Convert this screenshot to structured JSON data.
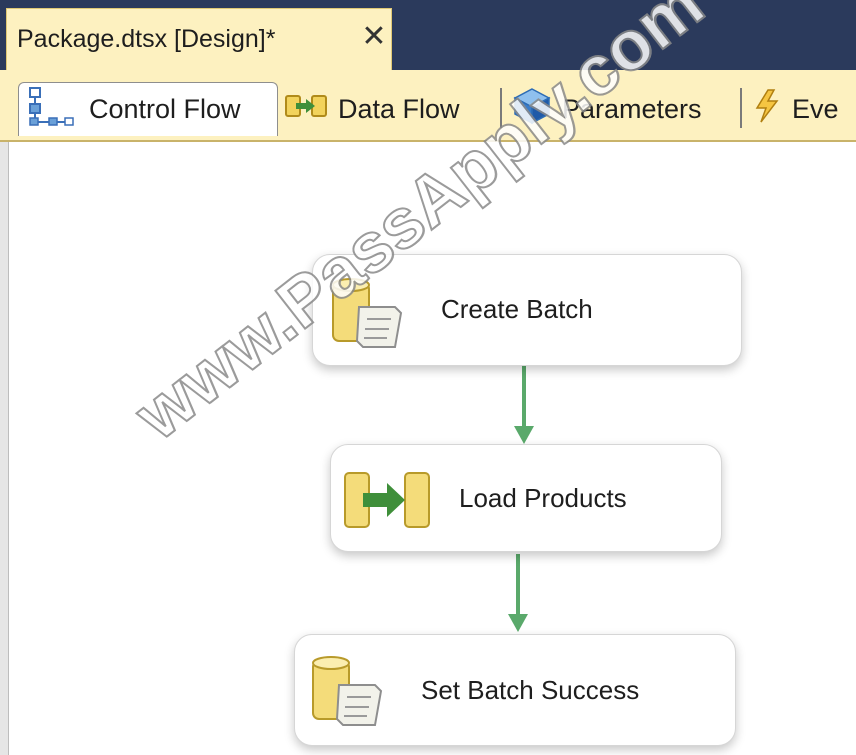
{
  "document_tab": {
    "title": "Package.dtsx [Design]*",
    "close_glyph": "✕"
  },
  "designer_tabs": [
    {
      "label": "Control Flow",
      "icon": "control-flow-icon",
      "active": true
    },
    {
      "label": "Data Flow",
      "icon": "data-flow-icon",
      "active": false
    },
    {
      "label": "Parameters",
      "icon": "parameters-icon",
      "active": false
    },
    {
      "label": "Eve",
      "icon": "event-handlers-icon",
      "active": false
    }
  ],
  "tasks": [
    {
      "label": "Create Batch",
      "icon": "execute-sql-task-icon"
    },
    {
      "label": "Load Products",
      "icon": "data-flow-task-icon"
    },
    {
      "label": "Set Batch Success",
      "icon": "execute-sql-task-icon"
    }
  ],
  "precedence_constraints": [
    {
      "from": "Create Batch",
      "to": "Load Products",
      "status": "success"
    },
    {
      "from": "Load Products",
      "to": "Set Batch Success",
      "status": "success"
    }
  ],
  "watermark": "www.PassApply.com",
  "colors": {
    "title_bar": "#2b3a5c",
    "tab_background": "#fdf1c0",
    "success_constraint": "#5aa96b",
    "task_border": "#d6d6d6"
  }
}
